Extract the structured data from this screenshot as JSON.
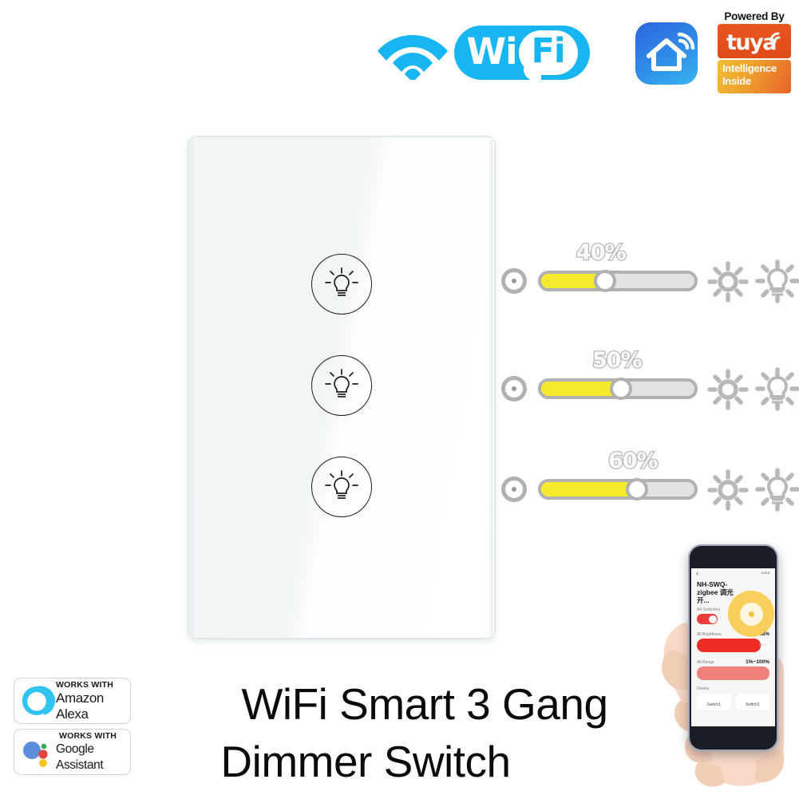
{
  "top_badges": {
    "wifi_signal_icon": "wifi-signal-icon",
    "wifi_logo": {
      "wi": "Wi",
      "fi": "Fi"
    },
    "smart_life_icon": "smart-home-app-icon",
    "tuya": {
      "powered_by": "Powered By",
      "brand": "tuya",
      "tagline_line1": "Intelligence",
      "tagline_line2": "Inside"
    }
  },
  "switch_panel": {
    "button_icon": "lightbulb-icon",
    "buttons": [
      {
        "id": "gang-1",
        "icon": "lightbulb-icon"
      },
      {
        "id": "gang-2",
        "icon": "lightbulb-icon"
      },
      {
        "id": "gang-3",
        "icon": "lightbulb-icon"
      }
    ]
  },
  "dimmers": [
    {
      "percent_label": "40%",
      "value": 40,
      "left_icon": "dim-dot-icon",
      "sun_icon": "sun-brightness-icon",
      "bulb_icon": "bulb-rays-icon"
    },
    {
      "percent_label": "50%",
      "value": 50,
      "left_icon": "dim-dot-icon",
      "sun_icon": "sun-brightness-icon",
      "bulb_icon": "bulb-rays-icon"
    },
    {
      "percent_label": "60%",
      "value": 60,
      "left_icon": "dim-dot-icon",
      "sun_icon": "sun-brightness-icon",
      "bulb_icon": "bulb-rays-icon"
    }
  ],
  "assistant_badges": [
    {
      "works_with": "WORKS WITH",
      "name": "Amazon Alexa",
      "icon": "alexa-ring-icon"
    },
    {
      "works_with": "WORKS WITH",
      "name": "Google Assistant",
      "icon": "google-assistant-dots-icon"
    }
  ],
  "headline": {
    "line1": "WiFi  Smart 3 Gang",
    "line2": "Dimmer Switch"
  },
  "phone": {
    "back_icon": "‹",
    "more_icon": "•••",
    "device_title": "NH-SWQ-zigbee 调光开...",
    "all_switches_label": "All Switches",
    "all_brightness_label": "All Brightness",
    "all_brightness_value": "88%",
    "brightness_max_hint": "100%",
    "all_range_label": "All Range",
    "all_range_value": "1%~100%",
    "device_label": "Device",
    "device_cards": [
      "Switch1",
      "Switch2"
    ]
  },
  "colors": {
    "wifi_cyan": "#17b6f2",
    "tuya_orange": "#ea5520",
    "slider_yellow": "#f7e92c",
    "slider_gray": "#b1b1b1",
    "app_red": "#ee2b24",
    "app_yellow": "#f7cf5a"
  }
}
